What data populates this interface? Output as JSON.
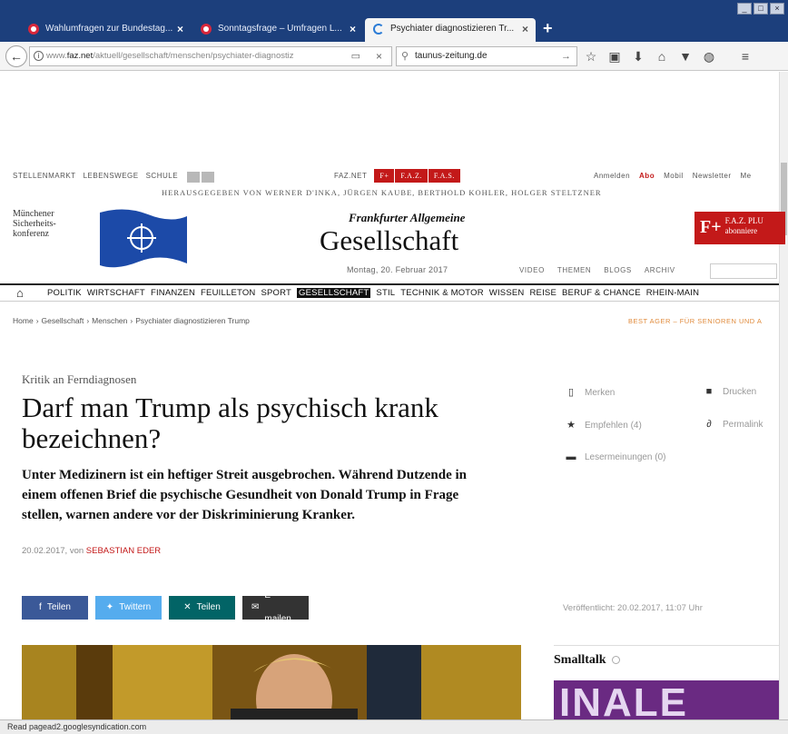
{
  "browser": {
    "tabs": [
      {
        "label": "Wahlumfragen zur Bundestag..."
      },
      {
        "label": "Sonntagsfrage – Umfragen L..."
      },
      {
        "label": "Psychiater diagnostizieren Tr..."
      }
    ],
    "tab_close": "×",
    "new_tab": "+",
    "window_controls": [
      "_",
      "□",
      "×"
    ],
    "back": "←",
    "url_prefix": "www.",
    "url_domain": "faz.net",
    "url_path": "/aktuell/gesellschaft/menschen/psychiater-diagnostiz",
    "search_value": "taunus-zeitung.de",
    "status": "Read pagead2.googlesyndication.com",
    "icons": [
      "star-icon",
      "clipboard-icon",
      "download-icon",
      "home-icon",
      "pocket-icon",
      "globe-icon",
      "menu-icon"
    ]
  },
  "site": {
    "services": [
      "STELLENMARKT",
      "LEBENSWEGE",
      "SCHULE"
    ],
    "faznet": "FAZ.NET",
    "brand_tabs": [
      "F+",
      "F.A.Z.",
      "F.A.S."
    ],
    "user_links": [
      "Anmelden",
      "Abo",
      "Mobil",
      "Newsletter",
      "Me"
    ],
    "editors": "HERAUSGEGEBEN VON WERNER D'INKA, JÜRGEN KAUBE, BERTHOLD KOHLER, HOLGER STELTZNER",
    "promo_left": "Münchener Sicherheits-konferenz",
    "logo": "Frankfurter Allgemeine",
    "section": "Gesellschaft",
    "date": "Montag, 20. Februar 2017",
    "subnav": [
      "VIDEO",
      "THEMEN",
      "BLOGS",
      "ARCHIV"
    ],
    "promo_right_fplus": "F+",
    "promo_right_line1": "F.A.Z. PLU",
    "promo_right_line2": "abonniere",
    "nav": [
      "POLITIK",
      "WIRTSCHAFT",
      "FINANZEN",
      "FEUILLETON",
      "SPORT",
      "GESELLSCHAFT",
      "STIL",
      "TECHNIK & MOTOR",
      "WISSEN",
      "REISE",
      "BERUF & CHANCE",
      "RHEIN-MAIN"
    ],
    "breadcrumb": [
      "Home",
      "Gesellschaft",
      "Menschen",
      "Psychiater diagnostizieren Trump"
    ],
    "breadcrumb_sep": "›",
    "ad_teaser": "BEST AGER – FÜR SENIOREN UND A"
  },
  "article": {
    "kicker": "Kritik an Ferndiagnosen",
    "headline": "Darf man Trump als psychisch krank bezeichnen?",
    "teaser": "Unter Medizinern ist ein heftiger Streit ausgebrochen. Während Dutzende in einem offenen Brief die psychische Gesundheit von Donald Trump in Frage stellen, warnen andere vor der Diskriminierung Kranker.",
    "date": "20.02.2017, von",
    "author": "SEBASTIAN EDER",
    "tools": {
      "merken": "Merken",
      "drucken": "Drucken",
      "empfehlen": "Empfehlen (4)",
      "permalink": "Permalink",
      "lesermeinungen": "Lesermeinungen (0)"
    },
    "share": {
      "facebook": "Teilen",
      "twitter": "Twittern",
      "xing": "Teilen",
      "email": "E-mailen"
    },
    "published": "Veröffentlicht: 20.02.2017, 11:07 Uhr"
  },
  "sidebar": {
    "smalltalk": "Smalltalk",
    "smalltalk_image_text": "INALE"
  },
  "colors": {
    "faz_red": "#c31919",
    "titlebar": "#1c3f7c",
    "facebook": "#3b5998",
    "twitter": "#55acee",
    "xing": "#026466"
  }
}
